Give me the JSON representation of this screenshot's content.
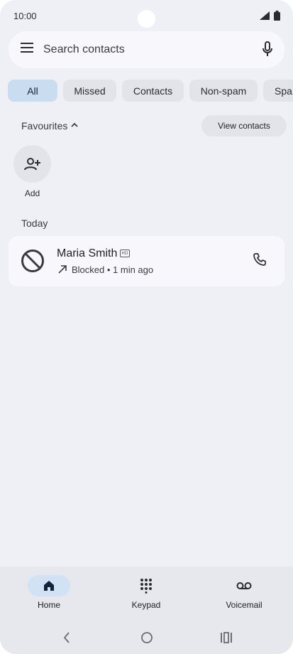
{
  "status_bar": {
    "time": "10:00"
  },
  "search": {
    "placeholder": "Search contacts"
  },
  "filter_chips": [
    {
      "label": "All",
      "selected": true
    },
    {
      "label": "Missed",
      "selected": false
    },
    {
      "label": "Contacts",
      "selected": false
    },
    {
      "label": "Non-spam",
      "selected": false
    },
    {
      "label": "Spa",
      "selected": false
    }
  ],
  "favourites": {
    "label": "Favourites",
    "view_contacts_label": "View contacts",
    "add_label": "Add"
  },
  "recents": {
    "section_label": "Today",
    "calls": [
      {
        "name": "Maria Smith",
        "hd_badge": "HD",
        "detail": "Blocked • 1 min ago"
      }
    ]
  },
  "bottom_nav": [
    {
      "label": "Home",
      "icon": "home-icon",
      "active": true
    },
    {
      "label": "Keypad",
      "icon": "dialpad-icon",
      "active": false
    },
    {
      "label": "Voicemail",
      "icon": "voicemail-icon",
      "active": false
    }
  ],
  "colors": {
    "background": "#eef0f6",
    "surface": "#f8f8fc",
    "chip": "#e3e4ea",
    "chip_selected": "#c9dcf0",
    "nav_active": "#d2e2f5"
  }
}
